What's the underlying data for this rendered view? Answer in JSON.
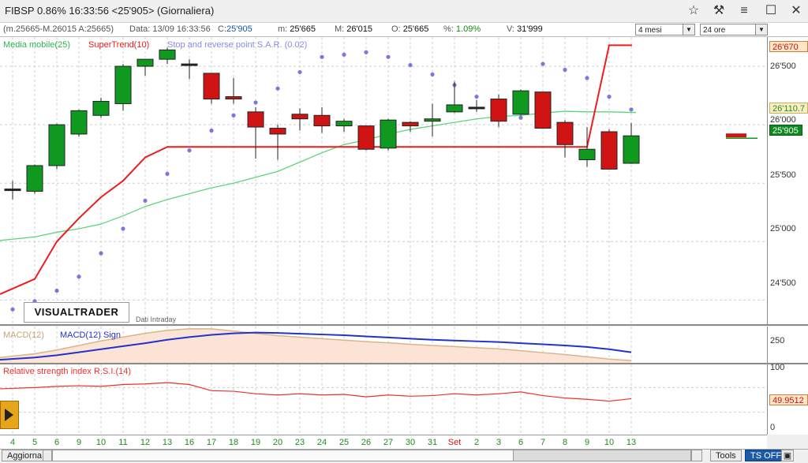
{
  "window": {
    "title": "FIBSP 0.86% 16:33:56  <25'905> (Giornaliera)",
    "controls": [
      "☆",
      "⚒",
      "≡",
      "☐",
      "✕"
    ]
  },
  "info": {
    "ohlc": "(m.25665-M.26015 A:25665)",
    "data_label": "Data: 13/09 16:33:56",
    "close_label": "C:",
    "close_value": "25'905",
    "min_label": "m:",
    "min_value": "25'665",
    "max_label": "M:",
    "max_value": "26'015",
    "open_label": "O:",
    "open_value": "25'665",
    "pct_label": "%:",
    "pct_value": "1.09%",
    "vol_label": "V:",
    "vol_value": "31'999"
  },
  "selectors": {
    "period": "4 mesi",
    "timeframe": "24 ore"
  },
  "legend": {
    "ma": "Media mobile(25)",
    "supertrend": "SuperTrend(10)",
    "sar": "Stop and reverse point S.A.R. (0.02)",
    "macd": "MACD(12)",
    "macd_sign": "MACD(12) Sign",
    "rsi": "Relative strength index R.S.I.(14)"
  },
  "logo": "VISUALTRADER",
  "source": "Dati Intraday",
  "price_axis": {
    "labels": [
      "26'500",
      "26'000",
      "25'500",
      "25'000",
      "24'500"
    ],
    "supertrend_box": "26'670",
    "ma_box": "26'110.7",
    "last_box": "25'905"
  },
  "macd_axis": {
    "labels": [
      "250"
    ]
  },
  "rsi_axis": {
    "labels": [
      "100",
      "50",
      "0"
    ],
    "value_box": "49.9512"
  },
  "x_labels": [
    "4",
    "5",
    "6",
    "9",
    "10",
    "11",
    "12",
    "13",
    "16",
    "17",
    "18",
    "19",
    "20",
    "23",
    "24",
    "25",
    "26",
    "27",
    "30",
    "31",
    "Set",
    "2",
    "3",
    "6",
    "7",
    "8",
    "9",
    "10",
    "13"
  ],
  "status": {
    "aggiorna": "Aggiorna",
    "tools": "Tools",
    "ts_off": "TS OFF"
  },
  "colors": {
    "up": "#0f9a1f",
    "down": "#d01414",
    "ma": "#5cd67a",
    "supertrend": "#ee1c1c",
    "sar": "#7878e0",
    "macd": "#2233cc",
    "macd_sign": "#d8b58a",
    "rsi": "#ee3030",
    "x_label": "#1a8f1a",
    "x_label_month": "#d01414"
  },
  "chart_data": {
    "type": "candlestick",
    "categories": [
      "4",
      "5",
      "6",
      "9",
      "10",
      "11",
      "12",
      "13",
      "16",
      "17",
      "18",
      "19",
      "20",
      "23",
      "24",
      "25",
      "26",
      "27",
      "30",
      "31",
      "Set",
      "2",
      "3",
      "6",
      "7",
      "8",
      "9",
      "10",
      "13"
    ],
    "candles": [
      {
        "o": 25440,
        "h": 25520,
        "l": 25360,
        "c": 25450
      },
      {
        "o": 25430,
        "h": 25660,
        "l": 25410,
        "c": 25650
      },
      {
        "o": 25650,
        "h": 26010,
        "l": 25620,
        "c": 26000
      },
      {
        "o": 25920,
        "h": 26130,
        "l": 25900,
        "c": 26120
      },
      {
        "o": 26080,
        "h": 26230,
        "l": 26060,
        "c": 26200
      },
      {
        "o": 26180,
        "h": 26520,
        "l": 26120,
        "c": 26500
      },
      {
        "o": 26500,
        "h": 26560,
        "l": 26420,
        "c": 26560
      },
      {
        "o": 26560,
        "h": 26660,
        "l": 26520,
        "c": 26640
      },
      {
        "o": 26520,
        "h": 26560,
        "l": 26390,
        "c": 26520
      },
      {
        "o": 26440,
        "h": 26440,
        "l": 26180,
        "c": 26220
      },
      {
        "o": 26240,
        "h": 26400,
        "l": 26180,
        "c": 26220
      },
      {
        "o": 26110,
        "h": 26150,
        "l": 25710,
        "c": 25980
      },
      {
        "o": 25970,
        "h": 26000,
        "l": 25700,
        "c": 25920
      },
      {
        "o": 26090,
        "h": 26140,
        "l": 25950,
        "c": 26050
      },
      {
        "o": 26080,
        "h": 26150,
        "l": 25930,
        "c": 25990
      },
      {
        "o": 25990,
        "h": 26050,
        "l": 25940,
        "c": 26030
      },
      {
        "o": 25990,
        "h": 25990,
        "l": 25780,
        "c": 25790
      },
      {
        "o": 25800,
        "h": 26050,
        "l": 25780,
        "c": 26040
      },
      {
        "o": 26020,
        "h": 26030,
        "l": 25940,
        "c": 25990
      },
      {
        "o": 26030,
        "h": 26180,
        "l": 25900,
        "c": 26050
      },
      {
        "o": 26110,
        "h": 26370,
        "l": 26100,
        "c": 26170
      },
      {
        "o": 26150,
        "h": 26210,
        "l": 26110,
        "c": 26150
      },
      {
        "o": 26220,
        "h": 26260,
        "l": 25980,
        "c": 26030
      },
      {
        "o": 26090,
        "h": 26300,
        "l": 26080,
        "c": 26290
      },
      {
        "o": 26280,
        "h": 26280,
        "l": 25980,
        "c": 25970
      },
      {
        "o": 26020,
        "h": 26040,
        "l": 25720,
        "c": 25830
      },
      {
        "o": 25700,
        "h": 25980,
        "l": 25640,
        "c": 25790
      },
      {
        "o": 25940,
        "h": 25960,
        "l": 25620,
        "c": 25620
      },
      {
        "o": 25670,
        "h": 26015,
        "l": 25665,
        "c": 25905
      }
    ],
    "moving_average": [
      25010,
      25040,
      25080,
      25110,
      25150,
      25220,
      25300,
      25360,
      25410,
      25460,
      25500,
      25550,
      25600,
      25680,
      25760,
      25830,
      25870,
      25920,
      25960,
      25990,
      26020,
      26050,
      26070,
      26080,
      26100,
      26115,
      26110,
      26110,
      26105
    ],
    "supertrend": [
      24550,
      24680,
      25000,
      25200,
      25380,
      25520,
      25720,
      25810,
      25810,
      25810,
      25810,
      25810,
      25810,
      25810,
      25810,
      25810,
      25810,
      25810,
      25810,
      25810,
      25810,
      25810,
      25810,
      25810,
      25810,
      25810,
      25810,
      26680,
      26680
    ],
    "sar": [
      24420,
      24490,
      24580,
      24700,
      24900,
      25110,
      25350,
      25580,
      25780,
      25950,
      26080,
      26190,
      26310,
      26450,
      26580,
      26600,
      26620,
      26580,
      26510,
      26430,
      26340,
      26240,
      26150,
      26060,
      26520,
      26470,
      26400,
      26240,
      26130
    ],
    "price_ylim": [
      24300,
      26750
    ],
    "macd": [
      230,
      236,
      242,
      250,
      258,
      266,
      274,
      283,
      290,
      296,
      300,
      302,
      301,
      299,
      297,
      295,
      292,
      289,
      286,
      283,
      281,
      279,
      277,
      274,
      271,
      268,
      264,
      258,
      250
    ],
    "macd_signal": [
      236,
      246,
      256,
      268,
      280,
      290,
      300,
      308,
      312,
      312,
      306,
      300,
      294,
      290,
      286,
      282,
      278,
      275,
      271,
      268,
      265,
      262,
      259,
      254,
      249,
      244,
      238,
      232,
      228
    ],
    "macd_ylim": [
      222,
      318
    ],
    "rsi": [
      68,
      70,
      72,
      73,
      72,
      75,
      76,
      78,
      75,
      65,
      64,
      60,
      58,
      60,
      58,
      59,
      55,
      58,
      56,
      57,
      60,
      58,
      60,
      63,
      57,
      53,
      51,
      48,
      52
    ],
    "rsi_ylim": [
      0,
      100
    ]
  }
}
